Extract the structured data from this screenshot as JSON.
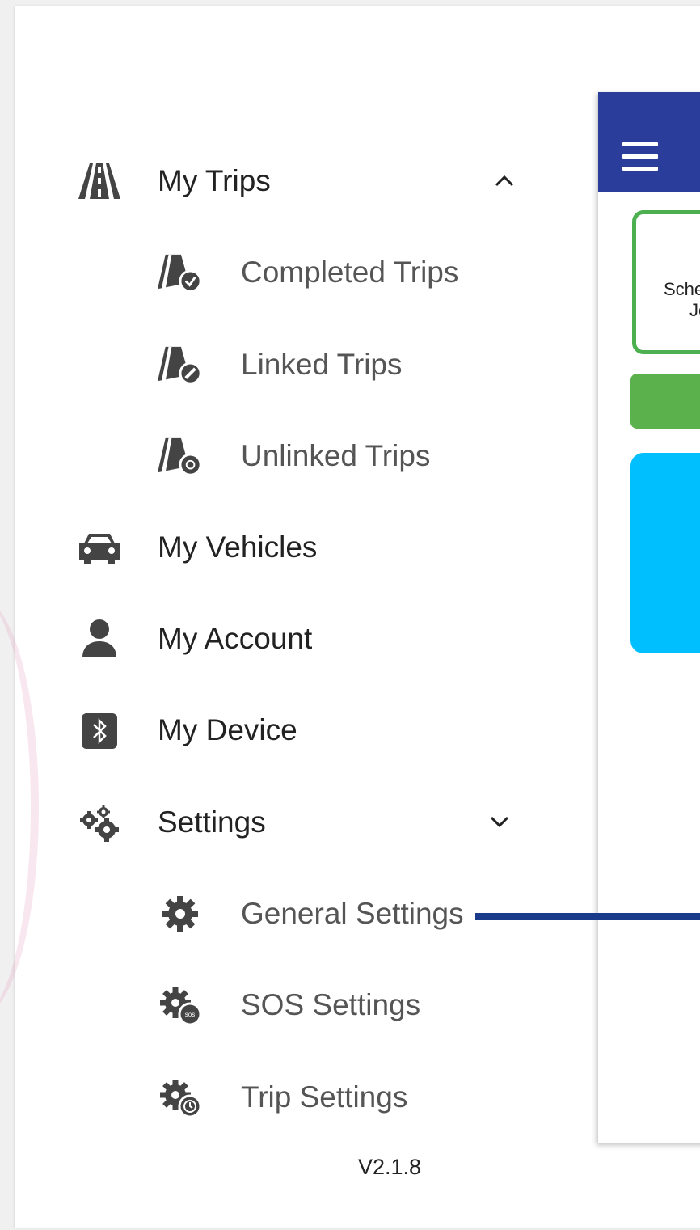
{
  "menu": {
    "my_trips": "My Trips",
    "completed_trips": "Completed Trips",
    "linked_trips": "Linked Trips",
    "unlinked_trips": "Unlinked Trips",
    "my_vehicles": "My Vehicles",
    "my_account": "My Account",
    "my_device": "My Device",
    "settings": "Settings",
    "general_settings": "General Settings",
    "sos_settings": "SOS Settings",
    "trip_settings": "Trip Settings"
  },
  "version": "V2.1.8",
  "preview": {
    "schedule_line1": "Sche",
    "schedule_line2": "Jo"
  },
  "icons": {
    "my_trips": "road-icon",
    "completed_trips": "road-check-icon",
    "linked_trips": "road-link-icon",
    "unlinked_trips": "road-unlink-icon",
    "my_vehicles": "car-icon",
    "my_account": "person-icon",
    "my_device": "bluetooth-icon",
    "settings": "gears-icon",
    "general_settings": "gear-icon",
    "sos_settings": "gear-sos-icon",
    "trip_settings": "gear-clock-icon"
  },
  "colors": {
    "app_bar": "#2a3d9a",
    "green": "#5bb24c",
    "blue_card": "#00bfff",
    "connector": "#1a3a8a",
    "icon": "#444444"
  }
}
